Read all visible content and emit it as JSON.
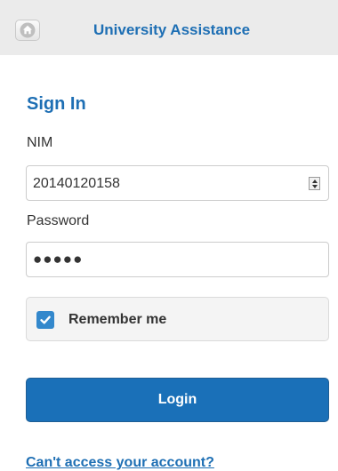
{
  "header": {
    "home_icon": "home-icon",
    "title": "University Assistance"
  },
  "form": {
    "title": "Sign In",
    "nim": {
      "label": "NIM",
      "value": "20140120158"
    },
    "password": {
      "label": "Password",
      "masked_value": "●●●●●"
    },
    "remember": {
      "label": "Remember me",
      "checked": true
    },
    "login_label": "Login",
    "help_link": "Can't access your account?"
  },
  "colors": {
    "accent": "#1e6fb4",
    "button": "#1a70b8",
    "checkbox": "#3388cc",
    "header_bg": "#ebebeb"
  }
}
